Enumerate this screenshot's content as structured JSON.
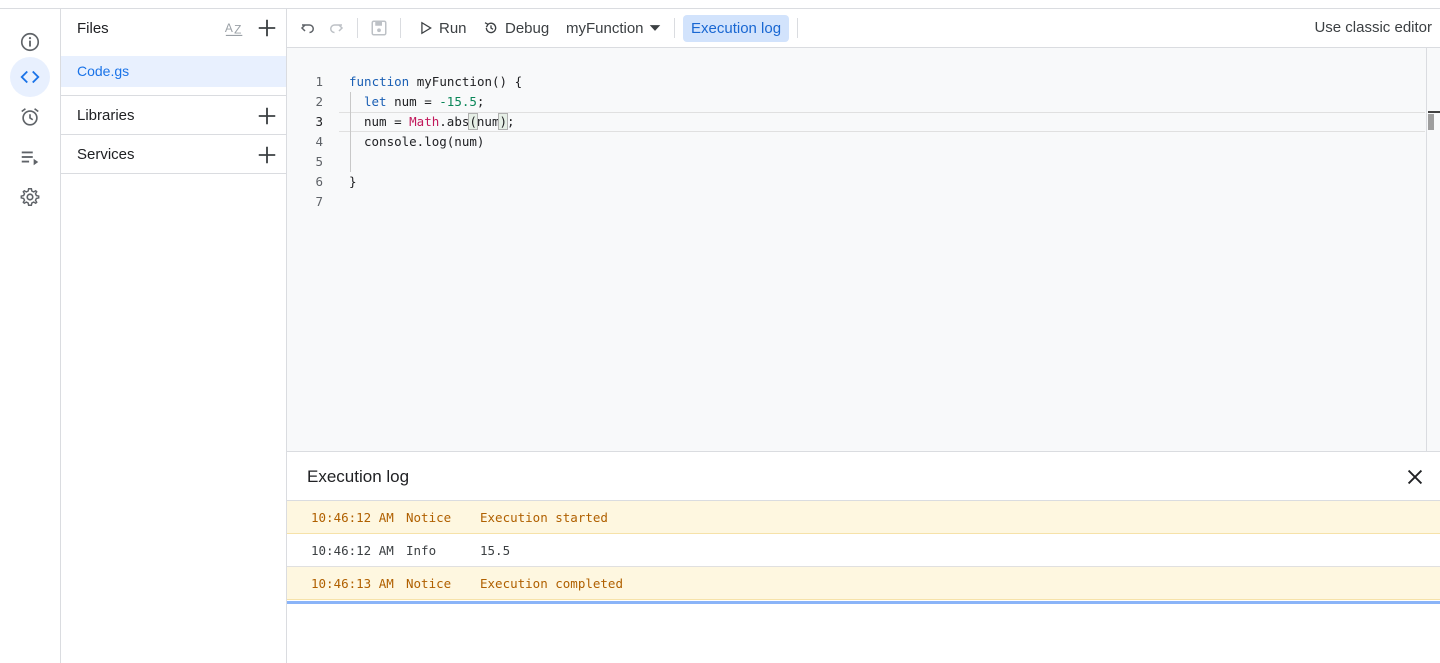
{
  "files_panel": {
    "title": "Files",
    "file_name": "Code.gs",
    "sections": [
      "Libraries",
      "Services"
    ]
  },
  "toolbar": {
    "run_label": "Run",
    "debug_label": "Debug",
    "function_select": "myFunction",
    "execution_log_label": "Execution log",
    "classic_editor_label": "Use classic editor"
  },
  "editor": {
    "line_numbers": [
      "1",
      "2",
      "3",
      "4",
      "5",
      "6",
      "7"
    ],
    "current_line": "3",
    "lines": {
      "l1_kw": "function",
      "l1_rest": " myFunction() {",
      "l2_kw": "let",
      "l2_mid": " num = ",
      "l2_num": "-15.5",
      "l2_end": ";",
      "l3_a": "num = ",
      "l3_math": "Math",
      "l3_b": ".abs",
      "l3_p1": "(",
      "l3_arg": "num",
      "l3_p2": ")",
      "l3_end": ";",
      "l4": "console.log(num)",
      "l6": "}"
    }
  },
  "execution_log": {
    "title": "Execution log",
    "rows": [
      {
        "time": "10:46:12 AM",
        "level": "Notice",
        "message": "Execution started"
      },
      {
        "time": "10:46:12 AM",
        "level": "Info",
        "message": "15.5"
      },
      {
        "time": "10:46:13 AM",
        "level": "Notice",
        "message": "Execution completed"
      }
    ]
  },
  "icons": {
    "rail": [
      "info-icon",
      "code-icon",
      "alarm-clock-icon",
      "executions-icon",
      "gear-icon"
    ],
    "toolbar": [
      "undo-icon",
      "redo-icon",
      "save-icon",
      "play-icon",
      "debug-icon",
      "dropdown-arrow-icon"
    ],
    "files": [
      "sort-az-icon",
      "add-icon"
    ],
    "log": [
      "close-icon"
    ]
  },
  "colors": {
    "accent": "#1a73e8",
    "active_bg": "#e8f0fe",
    "notice_bg": "#fef7e0",
    "notice_text": "#b06000"
  }
}
